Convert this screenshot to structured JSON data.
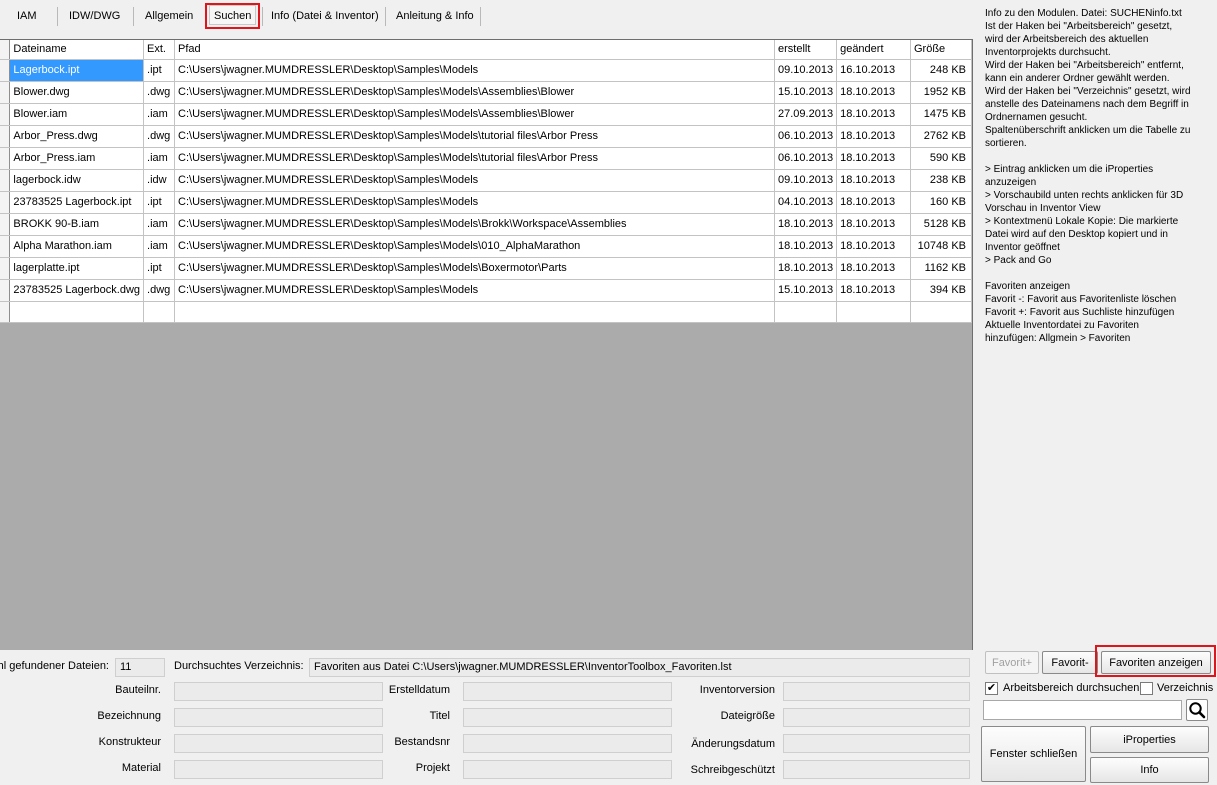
{
  "tabs": [
    {
      "label": "IAM"
    },
    {
      "label": "IDW/DWG"
    },
    {
      "label": "Allgemein"
    },
    {
      "label": "Suchen"
    },
    {
      "label": "Info (Datei & Inventor)"
    },
    {
      "label": "Anleitung & Info"
    }
  ],
  "active_tab": "Suchen",
  "grid": {
    "columns": [
      "Dateiname",
      "Ext.",
      "Pfad",
      "erstellt",
      "geändert",
      "Größe"
    ],
    "rows": [
      [
        "Lagerbock.ipt",
        ".ipt",
        "C:\\Users\\jwagner.MUMDRESSLER\\Desktop\\Samples\\Models",
        "09.10.2013",
        "16.10.2013",
        "248 KB"
      ],
      [
        "Blower.dwg",
        ".dwg",
        "C:\\Users\\jwagner.MUMDRESSLER\\Desktop\\Samples\\Models\\Assemblies\\Blower",
        "15.10.2013",
        "18.10.2013",
        "1952 KB"
      ],
      [
        "Blower.iam",
        ".iam",
        "C:\\Users\\jwagner.MUMDRESSLER\\Desktop\\Samples\\Models\\Assemblies\\Blower",
        "27.09.2013",
        "18.10.2013",
        "1475 KB"
      ],
      [
        "Arbor_Press.dwg",
        ".dwg",
        "C:\\Users\\jwagner.MUMDRESSLER\\Desktop\\Samples\\Models\\tutorial files\\Arbor Press",
        "06.10.2013",
        "18.10.2013",
        "2762 KB"
      ],
      [
        "Arbor_Press.iam",
        ".iam",
        "C:\\Users\\jwagner.MUMDRESSLER\\Desktop\\Samples\\Models\\tutorial files\\Arbor Press",
        "06.10.2013",
        "18.10.2013",
        "590 KB"
      ],
      [
        "lagerbock.idw",
        ".idw",
        "C:\\Users\\jwagner.MUMDRESSLER\\Desktop\\Samples\\Models",
        "09.10.2013",
        "18.10.2013",
        "238 KB"
      ],
      [
        "23783525 Lagerbock.ipt",
        ".ipt",
        "C:\\Users\\jwagner.MUMDRESSLER\\Desktop\\Samples\\Models",
        "04.10.2013",
        "18.10.2013",
        "160 KB"
      ],
      [
        "BROKK 90-B.iam",
        ".iam",
        "C:\\Users\\jwagner.MUMDRESSLER\\Desktop\\Samples\\Models\\Brokk\\Workspace\\Assemblies",
        "18.10.2013",
        "18.10.2013",
        "5128 KB"
      ],
      [
        "Alpha Marathon.iam",
        ".iam",
        "C:\\Users\\jwagner.MUMDRESSLER\\Desktop\\Samples\\Models\\010_AlphaMarathon",
        "18.10.2013",
        "18.10.2013",
        "10748 KB"
      ],
      [
        "lagerplatte.ipt",
        ".ipt",
        "C:\\Users\\jwagner.MUMDRESSLER\\Desktop\\Samples\\Models\\Boxermotor\\Parts",
        "18.10.2013",
        "18.10.2013",
        "1162 KB"
      ],
      [
        "23783525 Lagerbock.dwg",
        ".dwg",
        "C:\\Users\\jwagner.MUMDRESSLER\\Desktop\\Samples\\Models",
        "15.10.2013",
        "18.10.2013",
        "394 KB"
      ]
    ],
    "selected_row": 0
  },
  "status": {
    "count_label": "Anzahl gefundener Dateien:",
    "count_value": "11",
    "dir_label": "Durchsuchtes Verzeichnis:",
    "dir_value": "Favoriten aus Datei C:\\Users\\jwagner.MUMDRESSLER\\InventorToolbox_Favoriten.lst"
  },
  "props": {
    "bauteilnr": "Bauteilnr.",
    "bezeichnung": "Bezeichnung",
    "konstrukteur": "Konstrukteur",
    "material": "Material",
    "erstelldatum": "Erstelldatum",
    "titel": "Titel",
    "bestandsnr": "Bestandsnr",
    "projekt": "Projekt",
    "inventorversion": "Inventorversion",
    "dateigroesse": "Dateigröße",
    "aenderungsdatum": "Änderungsdatum",
    "schreibgeschuetzt": "Schreibgeschützt"
  },
  "help_text": "Info zu den Modulen. Datei: SUCHENinfo.txt\nIst der Haken bei \"Arbeitsbereich\" gesetzt,\nwird der Arbeitsbereich des aktuellen\nInventorprojekts durchsucht.\nWird der Haken bei \"Arbeitsbereich\" entfernt,\nkann ein anderer Ordner gewählt werden.\nWird der Haken bei \"Verzeichnis\" gesetzt, wird\nanstelle des Dateinamens nach dem Begriff in\nOrdnernamen gesucht.\nSpaltenüberschrift anklicken um die Tabelle zu\nsortieren.\n\n> Eintrag anklicken um die iProperties\nanzuzeigen\n> Vorschaubild unten rechts anklicken für 3D\nVorschau in Inventor View\n> Kontextmenü Lokale Kopie: Die markierte\nDatei wird auf den Desktop kopiert und in\nInventor geöffnet\n> Pack and Go\n\nFavoriten anzeigen\nFavorit -: Favorit aus Favoritenliste löschen\nFavorit +: Favorit aus Suchliste hinzufügen\nAktuelle Inventordatei zu Favoriten\nhinzufügen: Allgmein > Favoriten",
  "controls": {
    "fav_plus": "Favorit+",
    "fav_minus": "Favorit-",
    "fav_show": "Favoriten anzeigen",
    "chk_workspace_label": "Arbeitsbereich durchsuchen",
    "chk_workspace_checked": true,
    "chk_dir_label": "Verzeichnis",
    "chk_dir_checked": false,
    "search_value": "",
    "close": "Fenster schließen",
    "iproperties": "iProperties",
    "info": "Info"
  }
}
